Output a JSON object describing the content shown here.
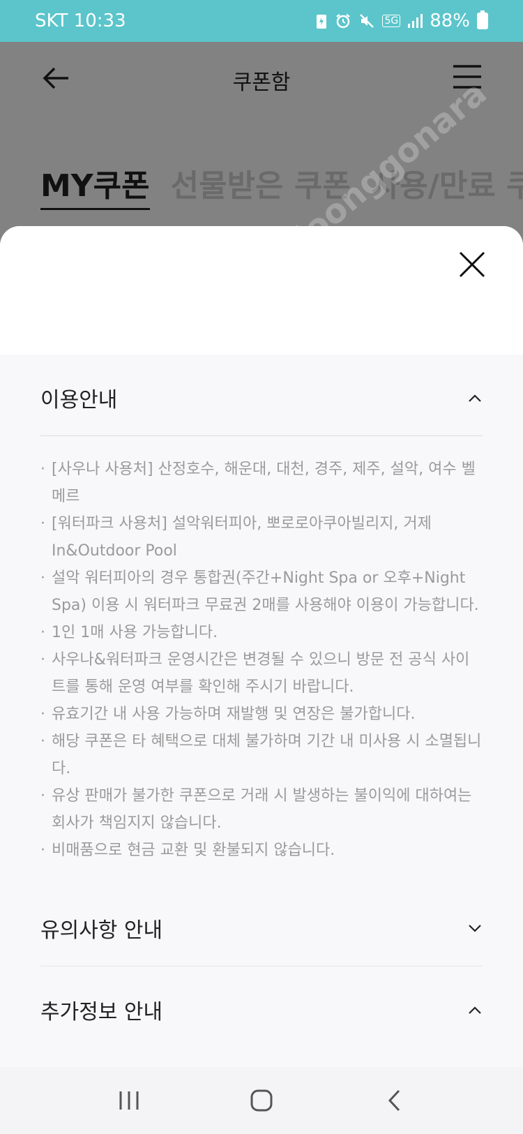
{
  "status_bar": {
    "carrier_time": "SKT 10:33",
    "network": "5G",
    "battery": "88%",
    "icons": [
      "battery-saver-icon",
      "alarm-icon",
      "mute-icon",
      "signal-icon"
    ]
  },
  "header": {
    "title": "쿠폰함",
    "back_icon": "back-arrow-icon",
    "menu_icon": "hamburger-menu-icon"
  },
  "tabs": [
    {
      "label": "MY쿠폰",
      "active": true
    },
    {
      "label": "선물받은 쿠폰",
      "active": false
    },
    {
      "label": "사용/만료 쿠",
      "active": false
    }
  ],
  "watermark": "m/joonggonara",
  "sheet": {
    "close_icon": "close-icon",
    "sections": [
      {
        "title": "이용안내",
        "expanded": true,
        "items": [
          "[사우나 사용처] 산정호수, 해운대, 대천, 경주, 제주, 설악, 여수 벨메르",
          "[워터파크 사용처] 설악워터피아, 뽀로로아쿠아빌리지, 거제 In&Outdoor Pool",
          "설악 워터피아의 경우 통합권(주간+Night Spa or 오후+Night Spa) 이용 시 워터파크 무료권 2매를 사용해야 이용이 가능합니다.",
          "1인 1매 사용 가능합니다.",
          "사우나&워터파크 운영시간은 변경될 수 있으니 방문 전 공식 사이트를 통해 운영 여부를 확인해 주시기 바랍니다.",
          "유효기간 내 사용 가능하며 재발행 및 연장은 불가합니다.",
          "해당 쿠폰은 타 혜택으로 대체 불가하며 기간 내 미사용 시 소멸됩니다.",
          "유상 판매가 불가한 쿠폰으로 거래 시 발생하는 불이익에 대하여는 회사가 책임지지 않습니다.",
          "비매품으로 현금 교환 및 환불되지 않습니다."
        ]
      },
      {
        "title": "유의사항 안내",
        "expanded": false
      },
      {
        "title": "추가정보 안내",
        "expanded": true
      }
    ]
  },
  "nav_bar": {
    "buttons": [
      "recent-apps-icon",
      "home-icon",
      "back-icon"
    ]
  }
}
